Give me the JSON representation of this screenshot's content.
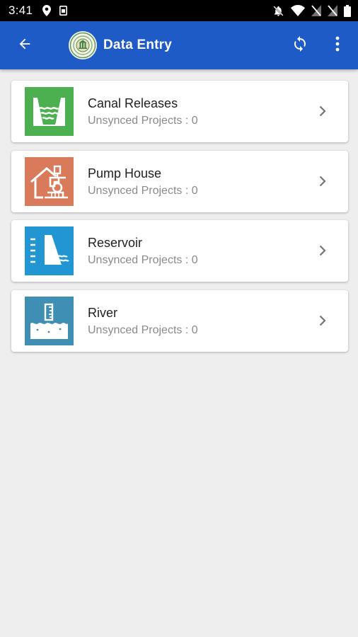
{
  "status_bar": {
    "time": "3:41",
    "icons": [
      "location-icon",
      "sim-icon",
      "notifications-off-icon",
      "wifi-icon",
      "signal-off-icon",
      "signal-off-icon",
      "battery-icon"
    ]
  },
  "app_bar": {
    "title": "Data Entry",
    "color": "#1e5bc6"
  },
  "categories": [
    {
      "title": "Canal Releases",
      "subtitle": "Unsynced Projects : 0",
      "icon": "canal-icon",
      "color": "#4caf50"
    },
    {
      "title": "Pump House",
      "subtitle": "Unsynced Projects : 0",
      "icon": "pump-house-icon",
      "color": "#d97a5b"
    },
    {
      "title": "Reservoir",
      "subtitle": "Unsynced Projects : 0",
      "icon": "reservoir-icon",
      "color": "#2196d3"
    },
    {
      "title": "River",
      "subtitle": "Unsynced Projects : 0",
      "icon": "river-icon",
      "color": "#3f8fb5"
    }
  ]
}
